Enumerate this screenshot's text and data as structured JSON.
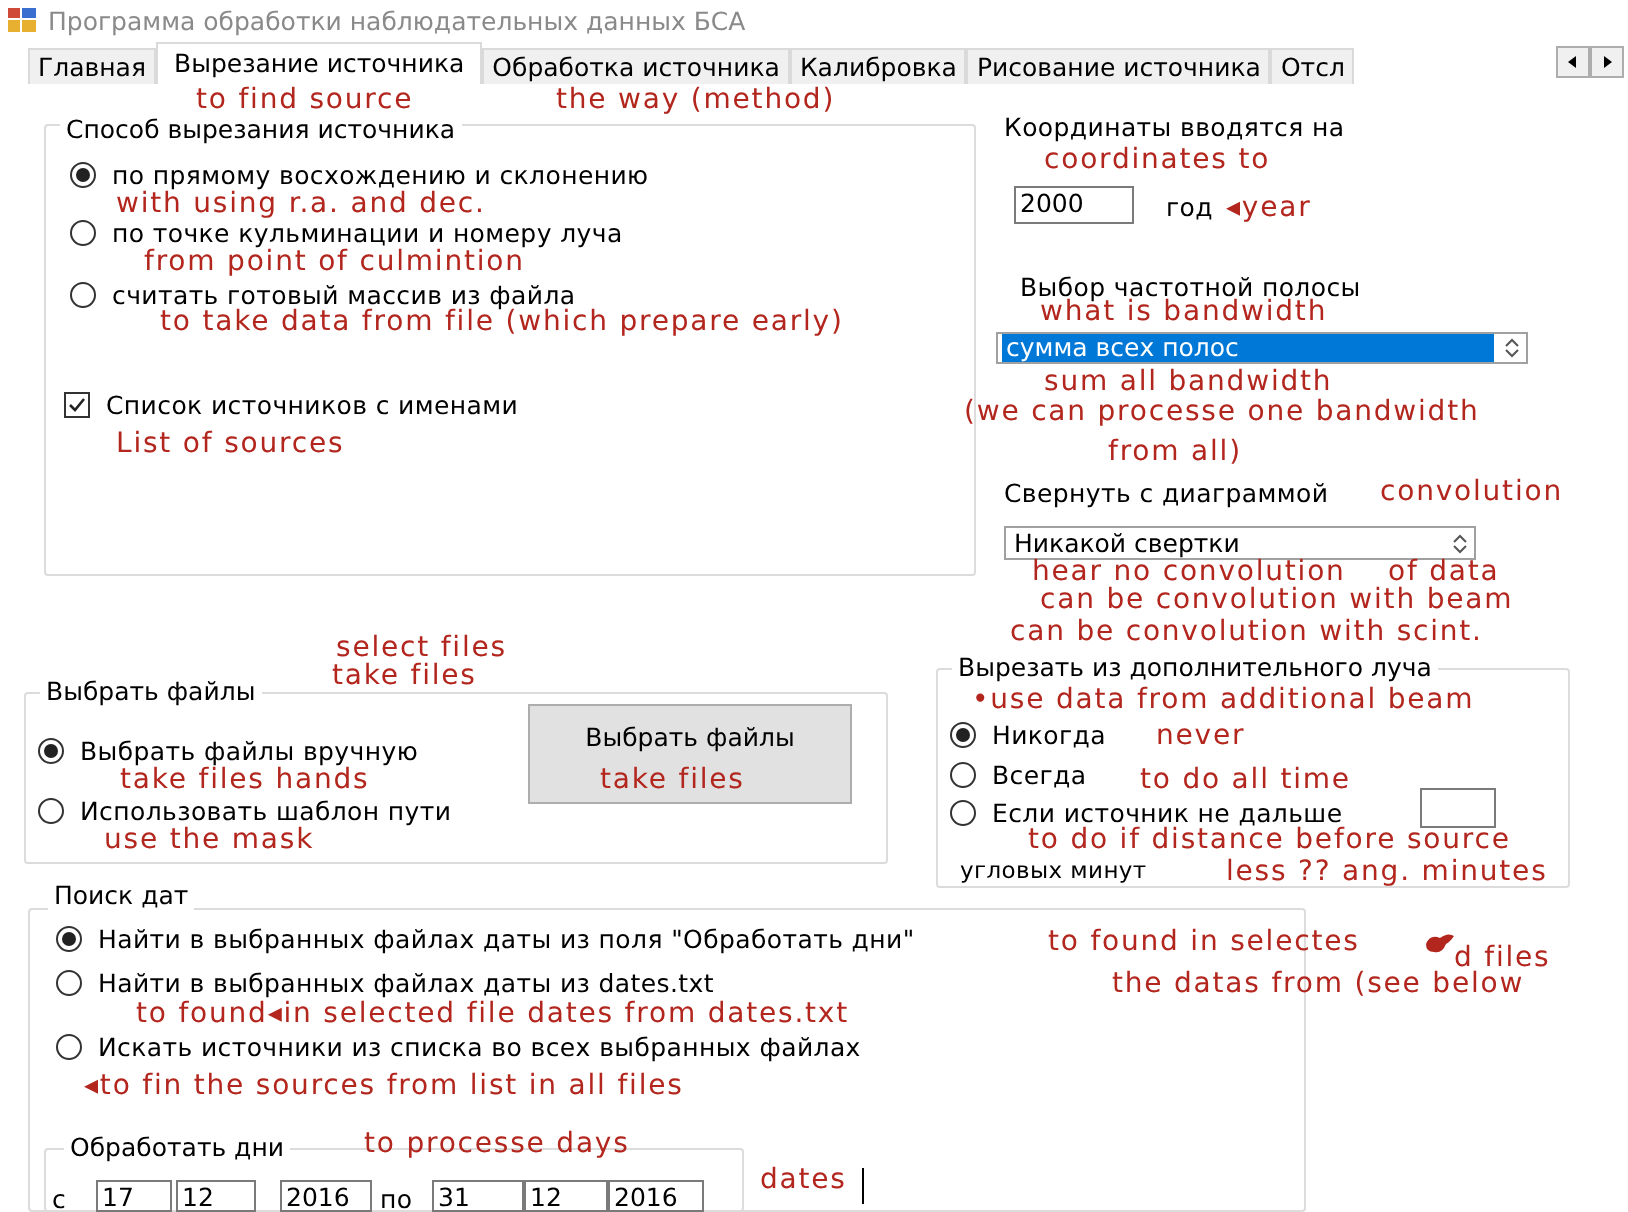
{
  "window": {
    "title": "Программа обработки наблюдательных данных БСА"
  },
  "tabs": [
    {
      "label": "Главная",
      "selected": false
    },
    {
      "label": "Вырезание источника",
      "selected": true
    },
    {
      "label": "Обработка источника",
      "selected": false
    },
    {
      "label": "Калибровка",
      "selected": false
    },
    {
      "label": "Рисование источника",
      "selected": false
    },
    {
      "label": "Отсл",
      "selected": false
    }
  ],
  "cut_method": {
    "title": "Способ вырезания источника",
    "options": [
      {
        "label": "по прямому восхождению и склонению",
        "selected": true
      },
      {
        "label": "по точке кульминации и номеру луча",
        "selected": false
      },
      {
        "label": "считать готовый массив из файла",
        "selected": false
      }
    ],
    "named_list": {
      "label": "Список источников с именами",
      "checked": true
    }
  },
  "coordinates": {
    "label": "Координаты вводятся на",
    "value": "2000",
    "unit": "год"
  },
  "band": {
    "label": "Выбор частотной полосы",
    "value": "сумма всех полос",
    "highlighted": true
  },
  "convolution": {
    "label": "Свернуть с диаграммой",
    "value": "Никакой свертки",
    "highlighted": false
  },
  "file_selection": {
    "title": "Выбрать файлы",
    "options": [
      {
        "label": "Выбрать файлы вручную",
        "selected": true
      },
      {
        "label": "Использовать шаблон пути",
        "selected": false
      }
    ],
    "button": "Выбрать файлы"
  },
  "extra_beam": {
    "title": "Вырезать из дополнительного луча",
    "options": [
      {
        "label": "Никогда",
        "selected": true
      },
      {
        "label": "Всегда",
        "selected": false
      },
      {
        "label": "Если источник не дальше",
        "selected": false
      }
    ],
    "units": "угловых минут"
  },
  "date_search": {
    "title": "Поиск дат",
    "options": [
      {
        "label": "Найти в выбранных файлах даты из поля \"Обработать дни\"",
        "selected": true
      },
      {
        "label": "Найти в выбранных файлах даты из dates.txt",
        "selected": false
      },
      {
        "label": "Искать источники из списка во всех выбранных файлах",
        "selected": false
      }
    ],
    "days": {
      "title": "Обработать дни",
      "from_label": "с",
      "from": [
        "17",
        "12",
        "2016"
      ],
      "to_label": "по",
      "to": [
        "31",
        "12",
        "2016"
      ]
    }
  },
  "annotations": [
    "to find source",
    "the way (method)",
    "coordinates to",
    "with using r.a. and dec.",
    "◂year",
    "from point of culmintion",
    "what is bandwidth",
    "to take data from file (which prepare early)",
    "sum all bandwidth",
    "(we can processe one bandwidth",
    "List of sources",
    "from all)",
    "convolution",
    "hear no convolution",
    "of data",
    "can be convolution with beam",
    "can be convolution with scint.",
    "select files",
    "take files",
    "•use data from additional beam",
    "never",
    "take files hands",
    "take files",
    "to do all time",
    "use the mask",
    "to do if distance before source",
    "less ?? ang. minutes",
    "to found in selectes",
    "d files",
    "the datas from (see below",
    "to found◂in selected file dates from dates.txt",
    "◂to fin the sources from list in all files",
    "to processe days",
    "dates"
  ]
}
